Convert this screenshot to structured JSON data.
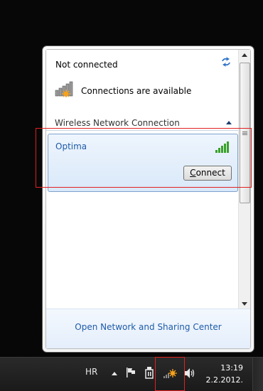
{
  "panel": {
    "status": "Not connected",
    "connections_text": "Connections are available",
    "section_title": "Wireless Network Connection",
    "network": {
      "name": "Optima",
      "connect_label": "Connect"
    },
    "footer_link": "Open Network and Sharing Center"
  },
  "taskbar": {
    "language": "HR",
    "time": "13:19",
    "date": "2.2.2012."
  },
  "icons": {
    "refresh": "refresh-icon",
    "connections": "network-warning-icon",
    "collapse": "chevron-up-icon",
    "signal": "signal-strength-icon",
    "tray_expand": "chevron-up-icon",
    "action_center": "flag-icon",
    "device": "usb-device-icon",
    "network_tray": "network-warning-icon",
    "volume": "speaker-icon"
  },
  "colors": {
    "link_blue": "#1e5ba8",
    "signal_green": "#3aa12a",
    "warning_orange": "#f7a21b",
    "annotation_red": "#e02020"
  }
}
